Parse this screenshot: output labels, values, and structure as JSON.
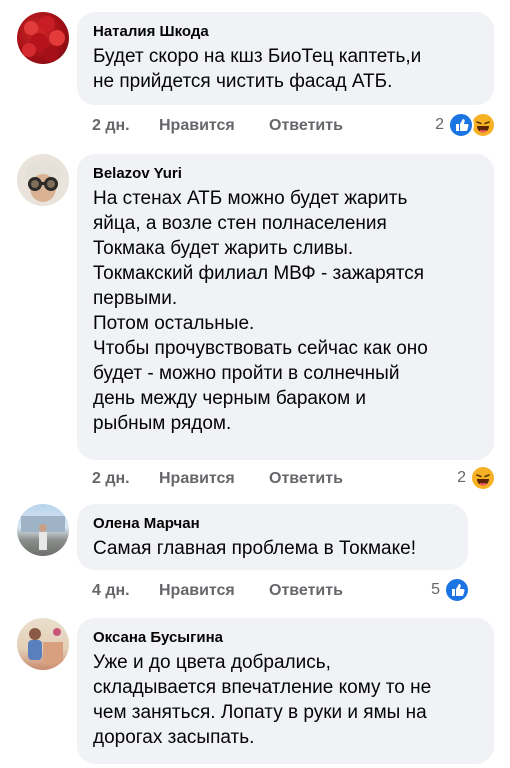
{
  "comments": [
    {
      "author": "Наталия Шкода",
      "text": "Будет скоро на кшз БиоТец каптеть,и\nне прийдется чистить фасад АТБ.",
      "time": "2 дн.",
      "like_label": "Нравится",
      "reply_label": "Ответить",
      "reaction_count": "2",
      "reactions": [
        "like-icon",
        "haha-icon"
      ]
    },
    {
      "author": "Belazov Yuri",
      "text": "На стенах АТБ можно будет жарить\nяйца, а возле стен полнаселения\nТокмака будет жарить сливы.\nТокмакский филиал МВФ - зажарятся\nпервыми.\nПотом остальные.\nЧтобы прочувствовать сейчас как оно\nбудет - можно пройти в солнечный\nдень между черным бараком и\nрыбным рядом.",
      "time": "2 дн.",
      "like_label": "Нравится",
      "reply_label": "Ответить",
      "reaction_count": "2",
      "reactions": [
        "haha-icon"
      ]
    },
    {
      "author": "Олена Марчан",
      "text": "Самая главная проблема в Токмаке!",
      "time": "4 дн.",
      "like_label": "Нравится",
      "reply_label": "Ответить",
      "reaction_count": "5",
      "reactions": [
        "like-icon"
      ]
    },
    {
      "author": "Оксана Бусыгина",
      "text": "Уже и до цвета добрались,\nскладывается впечатление кому то не\nчем заняться. Лопату в руки и ямы на\nдорогах засыпать.",
      "time": "",
      "like_label": "",
      "reply_label": "",
      "reaction_count": "",
      "reactions": []
    }
  ],
  "colors": {
    "bubble": "#f0f2f5",
    "meta_text": "#65676b",
    "like_blue": "#1b74e4",
    "haha_yellow": "#f7b125"
  }
}
